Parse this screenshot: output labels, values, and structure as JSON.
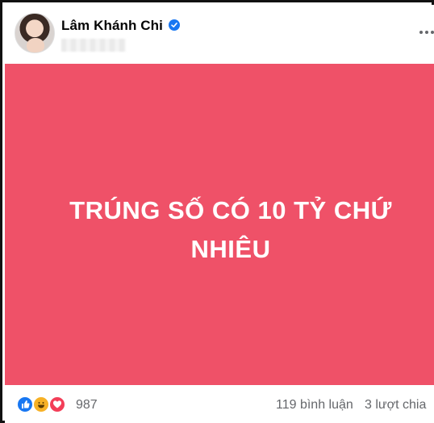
{
  "post": {
    "author_name": "Lâm Khánh Chi",
    "verified_icon": "verified-badge-icon",
    "more_icon": "more-options-icon",
    "content_text": "TRÚNG SỐ CÓ 10 TỶ CHỨ NHIÊU",
    "background_color": "#ef5168"
  },
  "footer": {
    "reaction_icons": [
      "like-icon",
      "haha-icon",
      "love-icon"
    ],
    "reaction_count": "987",
    "comments_label": "119 bình luận",
    "shares_label": "3 lượt chia"
  },
  "colors": {
    "brand_blue": "#1877f2",
    "text_secondary": "#65676b"
  }
}
